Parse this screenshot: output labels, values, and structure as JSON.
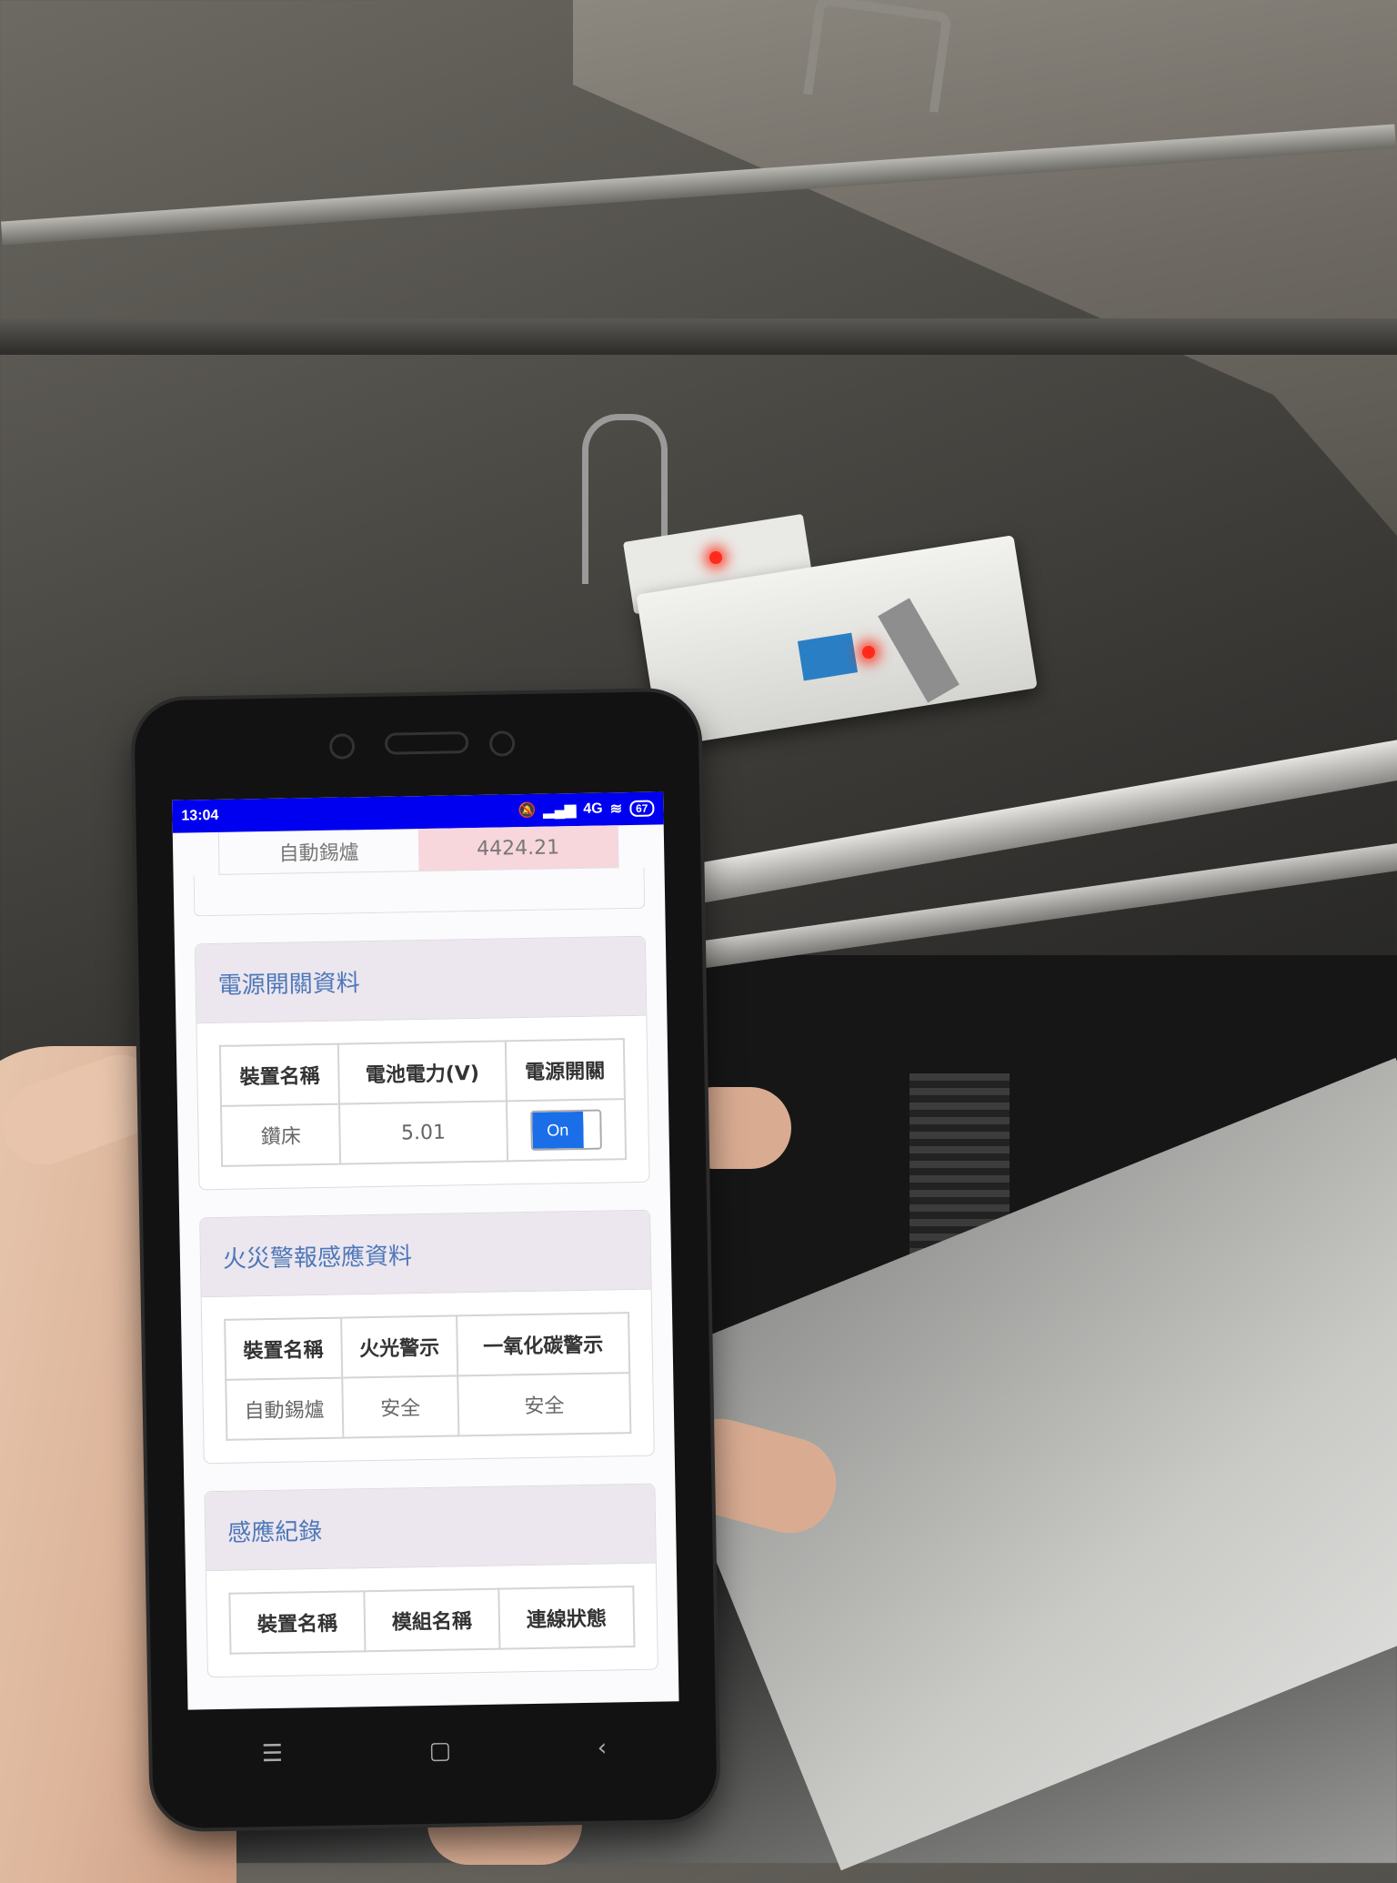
{
  "statusbar": {
    "time": "13:04",
    "network": "4G",
    "battery": "67"
  },
  "top_row": {
    "device": "自動錫爐",
    "value": "4424.21"
  },
  "power_card": {
    "title": "電源開關資料",
    "headers": [
      "裝置名稱",
      "電池電力(V)",
      "電源開關"
    ],
    "row": {
      "device": "鑽床",
      "voltage": "5.01",
      "toggle_label": "On"
    }
  },
  "fire_card": {
    "title": "火災警報感應資料",
    "headers": [
      "裝置名稱",
      "火光警示",
      "一氧化碳警示"
    ],
    "row": {
      "device": "自動錫爐",
      "flame": "安全",
      "co": "安全"
    }
  },
  "log_card": {
    "title": "感應紀錄",
    "headers": [
      "裝置名稱",
      "模組名稱",
      "連線狀態"
    ]
  },
  "navbar": {
    "menu_icon": "☰",
    "home_icon": "▢",
    "back_icon": "‹"
  },
  "colors": {
    "statusbar": "#0000f0",
    "card_title": "#4d78b8",
    "toggle_on": "#1a6ee8",
    "highlight": "#f7d6dc"
  }
}
